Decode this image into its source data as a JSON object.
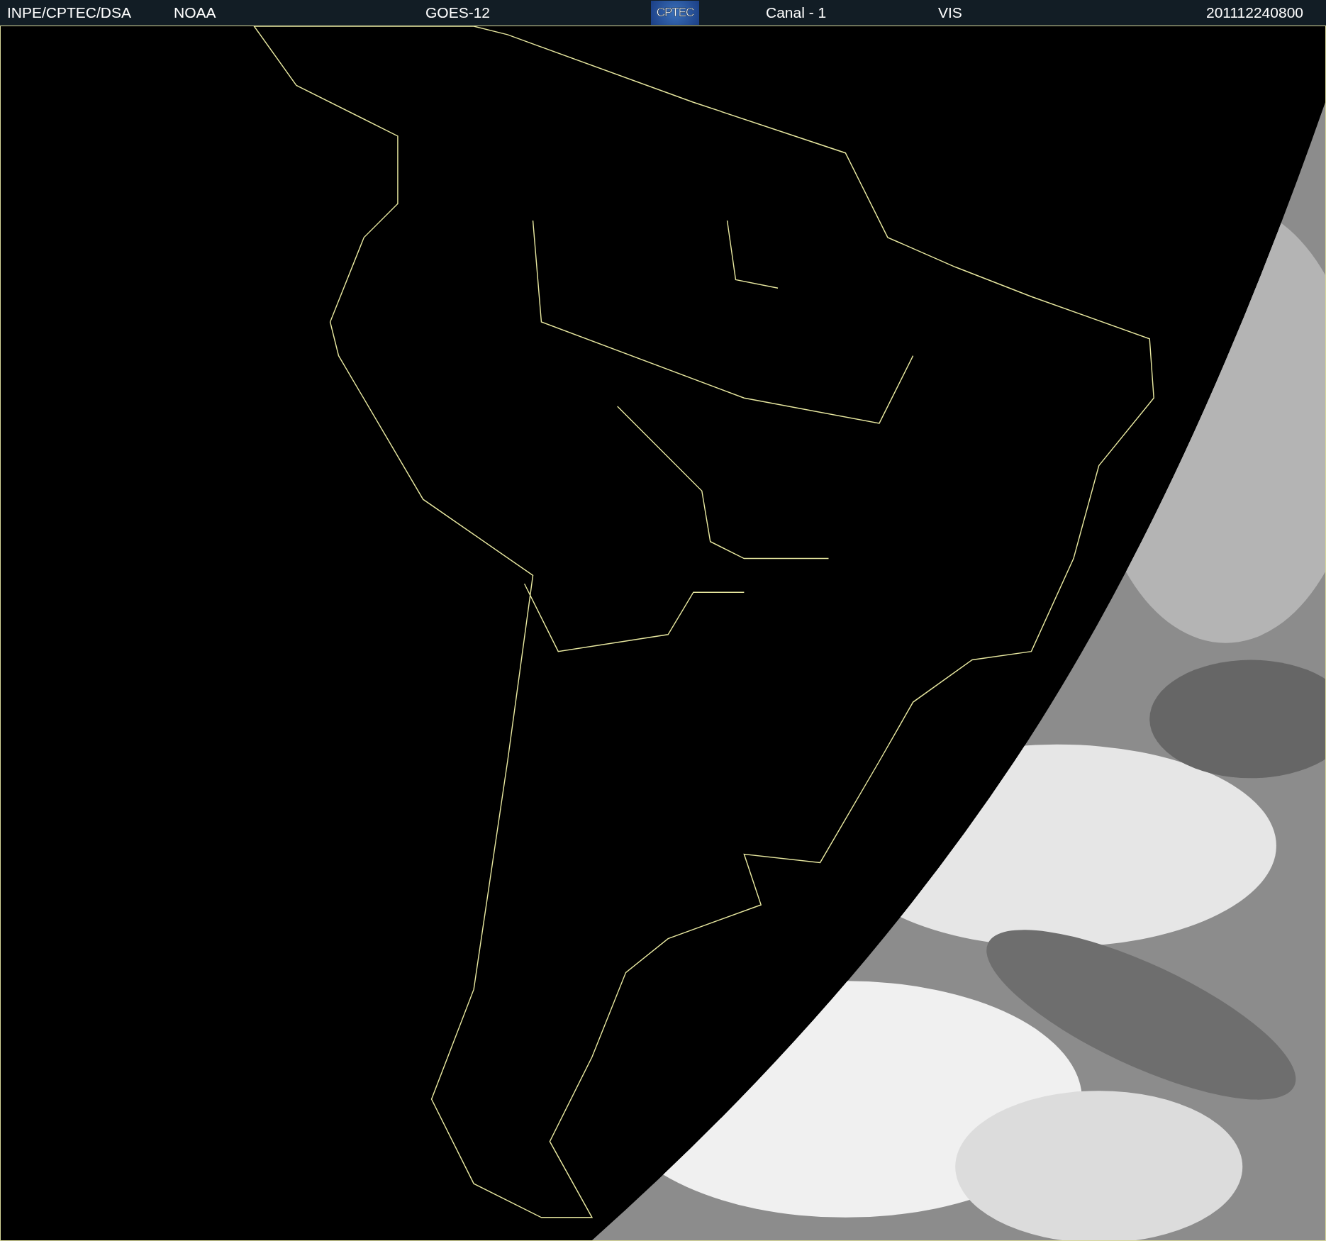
{
  "header": {
    "items": [
      {
        "kind": "text",
        "text": "INPE/CPTEC/DSA"
      },
      {
        "kind": "text",
        "text": "NOAA"
      },
      {
        "kind": "text",
        "text": "GOES-12"
      },
      {
        "kind": "logo",
        "text": "CPTEC"
      },
      {
        "kind": "text",
        "text": "Canal - 1"
      },
      {
        "kind": "text",
        "text": "VIS"
      },
      {
        "kind": "text",
        "text": "201112240800"
      }
    ]
  }
}
